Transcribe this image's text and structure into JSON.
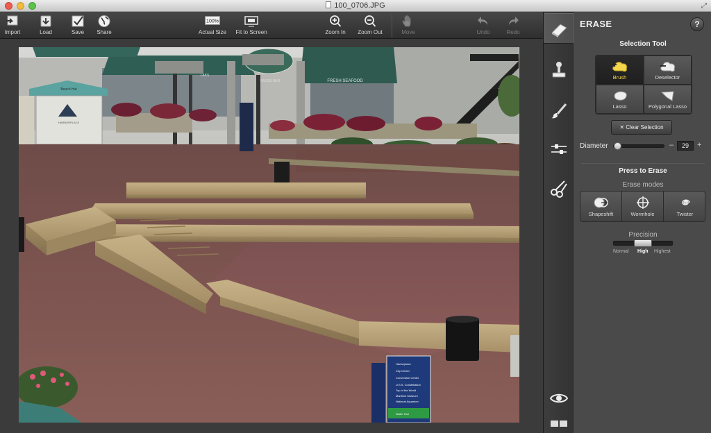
{
  "window": {
    "title": "100_0706.JPG"
  },
  "toolbar": {
    "import": "Import",
    "load": "Load",
    "save": "Save",
    "share": "Share",
    "actual_size": "Actual Size",
    "actual_size_badge": "100%",
    "fit_to_screen": "Fit to Screen",
    "zoom_in": "Zoom In",
    "zoom_out": "Zoom Out",
    "move": "Move",
    "undo": "Undo",
    "redo": "Redo"
  },
  "panel": {
    "title": "ERASE",
    "help": "?",
    "selection_tool": {
      "title": "Selection Tool",
      "tools": [
        "Brush",
        "Deselector",
        "Lasso",
        "Polygonal Lasso"
      ],
      "active": "Brush",
      "clear_button": "Clear Selection"
    },
    "diameter": {
      "label": "Diameter",
      "value": "29",
      "minus": "–",
      "plus": "+"
    },
    "press_to_erase": {
      "title": "Press to Erase",
      "modes_label": "Erase modes",
      "modes": [
        "Shapeshift",
        "Wormhole",
        "Twister"
      ]
    },
    "precision": {
      "title": "Precision",
      "options": [
        "Normal",
        "High",
        "Highest"
      ],
      "selected": "High"
    }
  },
  "photo": {
    "signs": {
      "shop_sign": "Beach Hut",
      "kiosk_sign": "HARBORPLACE",
      "mbs_sign": "MBS",
      "awning_text": "FRESH SEAFOOD",
      "awning_text2": "GRASSE BAR",
      "awning_text3": "LAKS",
      "directory": [
        "Harborplace",
        "City Center",
        "Convention Center",
        "U.S.S. Constellation",
        "Top of the World",
        "Maritime Museum",
        "National Aquarium",
        "Water Taxi"
      ]
    }
  },
  "colors": {
    "accent_active": "#f3d64a",
    "panel_bg": "#4a4a4a",
    "toolbar_bg": "#3a3a3a"
  }
}
